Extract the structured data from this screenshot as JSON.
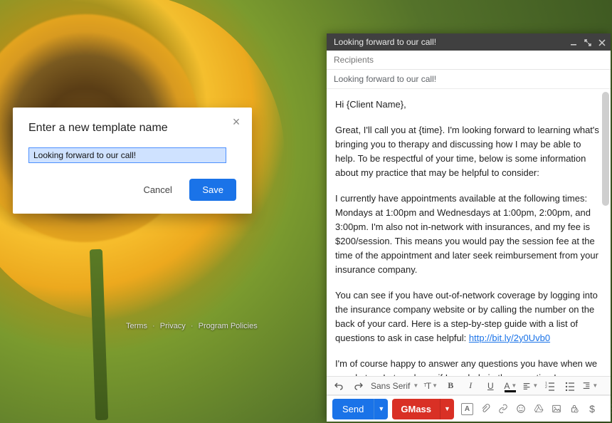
{
  "footer": {
    "terms": "Terms",
    "privacy": "Privacy",
    "policies": "Program Policies"
  },
  "dialog": {
    "title": "Enter a new template name",
    "input_value": "Looking forward to our call!",
    "cancel": "Cancel",
    "save": "Save"
  },
  "compose": {
    "header_title": "Looking forward to our call!",
    "recipients_label": "Recipients",
    "subject": "Looking forward to our call!",
    "body_p1": "Hi {Client Name},",
    "body_p2": "Great, I'll call you at {time}. I'm looking forward to learning what's bringing you to therapy and discussing how I may be able to help. To be respectful of your time, below is some information about my practice that may be helpful to consider:",
    "body_p3": "I currently have appointments available at the following times: Mondays at 1:00pm and Wednesdays at 1:00pm, 2:00pm, and 3:00pm. I'm also not in-network with insurances, and my fee is $200/session. This means you would pay the session fee at the time of the appointment and later seek reimbursement from your insurance company.",
    "body_p4_before": "You can see if you have out-of-network coverage by logging into the insurance company website or by calling the number on the back of your card. Here is a step-by-step guide with a list of questions to ask in case helpful: ",
    "body_p4_link": "http://bit.ly/2y0Uvb0",
    "body_p5": "I'm of course happy to answer any questions you have when we speak, too. Let me know if I can help in the meantime!"
  },
  "format_toolbar": {
    "font": "Sans Serif"
  },
  "actions": {
    "send": "Send",
    "gmass": "GMass"
  }
}
